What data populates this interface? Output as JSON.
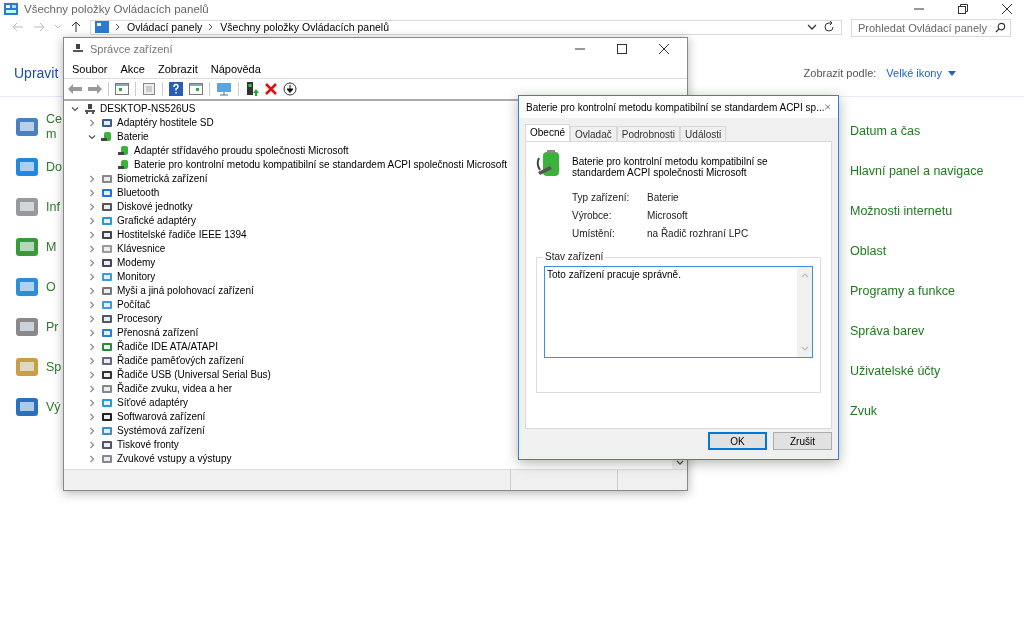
{
  "control_panel": {
    "title": "Všechny položky Ovládacích panelů",
    "breadcrumb": [
      "Ovládací panely",
      "Všechny položky Ovládacích panelů"
    ],
    "search": {
      "placeholder": "Prohledat Ovládací panely"
    },
    "heading": "Upravit",
    "view_label": "Zobrazit podle:",
    "view_value": "Velké ikony",
    "left_items": [
      {
        "label": "Ce\nm"
      },
      {
        "label": "Do"
      },
      {
        "label": "Inf"
      },
      {
        "label": "M"
      },
      {
        "label": "O"
      },
      {
        "label": "Pr"
      },
      {
        "label": "Sp"
      },
      {
        "label": "Vý"
      }
    ],
    "right_items": [
      {
        "label": "Datum a čas"
      },
      {
        "label": "Hlavní panel a navigace"
      },
      {
        "label": "Možnosti internetu"
      },
      {
        "label": "Oblast"
      },
      {
        "label": "Programy a funkce"
      },
      {
        "label": "Správa barev"
      },
      {
        "label": "Uživatelské účty"
      },
      {
        "label": "Zvuk"
      }
    ]
  },
  "device_manager": {
    "title": "Správce zařízení",
    "menu": [
      "Soubor",
      "Akce",
      "Zobrazit",
      "Nápověda"
    ],
    "tree": {
      "label": "DESKTOP-NS526US",
      "expanded": true,
      "children": [
        {
          "label": "Adaptéry hostitele SD",
          "expanded": false
        },
        {
          "label": "Baterie",
          "expanded": true,
          "children": [
            {
              "label": "Adaptér střídavého proudu společnosti Microsoft"
            },
            {
              "label": "Baterie pro kontrolní metodu kompatibilní se standardem ACPI společnosti Microsoft"
            }
          ]
        },
        {
          "label": "Biometrická zařízení",
          "expanded": false
        },
        {
          "label": "Bluetooth",
          "expanded": false
        },
        {
          "label": "Diskové jednotky",
          "expanded": false
        },
        {
          "label": "Grafické adaptéry",
          "expanded": false
        },
        {
          "label": "Hostitelské řadiče IEEE 1394",
          "expanded": false
        },
        {
          "label": "Klávesnice",
          "expanded": false
        },
        {
          "label": "Modemy",
          "expanded": false
        },
        {
          "label": "Monitory",
          "expanded": false
        },
        {
          "label": "Myši a jiná polohovací zařízení",
          "expanded": false
        },
        {
          "label": "Počítač",
          "expanded": false
        },
        {
          "label": "Procesory",
          "expanded": false
        },
        {
          "label": "Přenosná zařízení",
          "expanded": false
        },
        {
          "label": "Řadiče IDE ATA/ATAPI",
          "expanded": false
        },
        {
          "label": "Řadiče paměťových zařízení",
          "expanded": false
        },
        {
          "label": "Řadiče USB (Universal Serial Bus)",
          "expanded": false
        },
        {
          "label": "Řadiče zvuku, videa a her",
          "expanded": false
        },
        {
          "label": "Síťové adaptéry",
          "expanded": false
        },
        {
          "label": "Softwarová zařízení",
          "expanded": false
        },
        {
          "label": "Systémová zařízení",
          "expanded": false
        },
        {
          "label": "Tiskové fronty",
          "expanded": false
        },
        {
          "label": "Zvukové vstupy a výstupy",
          "expanded": false
        }
      ]
    }
  },
  "properties_dialog": {
    "title": "Baterie pro kontrolní metodu kompatibilní se standardem ACPI sp...",
    "tabs": [
      {
        "label": "Obecné",
        "selected": true
      },
      {
        "label": "Ovladač",
        "selected": false
      },
      {
        "label": "Podrobnosti",
        "selected": false
      },
      {
        "label": "Události",
        "selected": false
      }
    ],
    "device_name": "Baterie pro kontrolní metodu kompatibilní se standardem ACPI společnosti Microsoft",
    "properties": [
      {
        "label": "Typ zařízení:",
        "value": "Baterie"
      },
      {
        "label": "Výrobce:",
        "value": "Microsoft"
      },
      {
        "label": "Umístění:",
        "value": "na Řadič rozhraní LPC"
      }
    ],
    "status_group": "Stav zařízení",
    "status_text": "Toto zařízení pracuje správně.",
    "buttons": [
      {
        "label": "OK",
        "kind": "default"
      },
      {
        "label": "Zrušit",
        "kind": "normal"
      }
    ]
  }
}
